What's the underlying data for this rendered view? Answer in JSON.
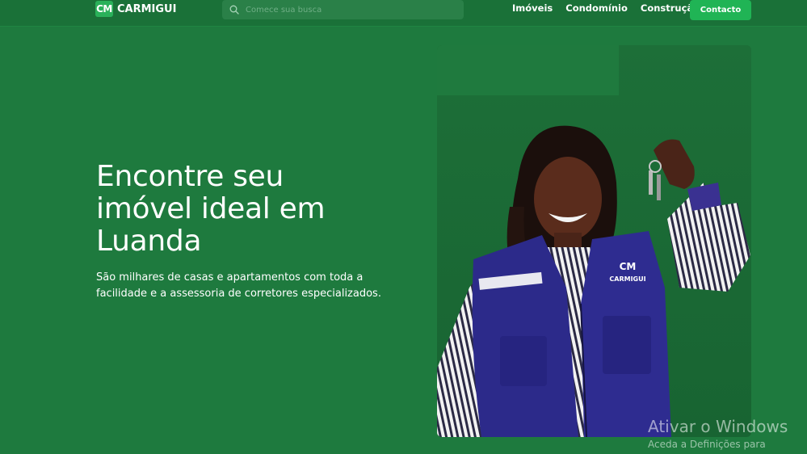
{
  "brand": {
    "mark": "CM",
    "name": "CARMIGUI"
  },
  "search": {
    "placeholder": "Comece sua busca"
  },
  "nav": {
    "items": [
      "Imóveis",
      "Condomínio",
      "Construção"
    ],
    "contact_label": "Contacto"
  },
  "hero": {
    "title": "Encontre seu imóvel ideal em Luanda",
    "subtitle": "São milhares de casas e apartamentos com toda a facilidade e a assessoria de corretores especializados."
  },
  "vest_logo": {
    "mark": "CM",
    "name": "CARMIGUI"
  },
  "watermark": {
    "title": "Ativar o Windows",
    "subtitle": "Aceda a Definições para"
  },
  "colors": {
    "background": "#1e7a3e",
    "header": "#1a7138",
    "accent": "#20b455"
  }
}
